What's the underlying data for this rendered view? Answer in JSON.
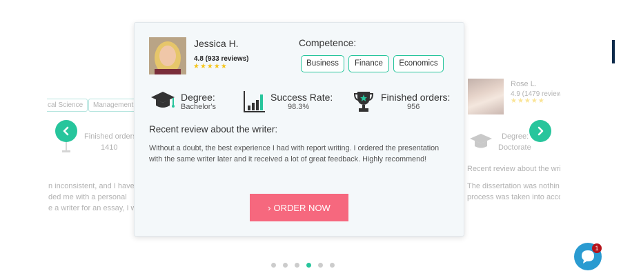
{
  "left_card": {
    "tags": [
      "cal Science",
      "Management"
    ],
    "finished_label": "Finished orders",
    "finished_value": "1410",
    "review_lines": [
      "n inconsistent, and I haven",
      "ded me with a personal",
      "e a writer for an essay, I wi"
    ]
  },
  "right_card": {
    "name": "Rose L.",
    "rating": "4.9 (1479 review",
    "stars": "★★★★★",
    "degree_label": "Degree:",
    "degree_value": "Doctorate",
    "review_title": "Recent review about the wri",
    "review_lines": [
      "The dissertation was nothin",
      "process was taken into acco"
    ]
  },
  "main_card": {
    "writer_name": "Jessica H.",
    "rating": "4.8 (933 reviews)",
    "stars": "★★★★★",
    "competence_title": "Competence:",
    "competence": [
      "Business",
      "Finance",
      "Economics"
    ],
    "degree_label": "Degree:",
    "degree_value": "Bachelor's",
    "success_label": "Success Rate:",
    "success_value": "98.3%",
    "finished_label": "Finished orders:",
    "finished_value": "956",
    "review_title": "Recent review about the writer:",
    "review_text": "Without a doubt, the best experience I had with report writing. I ordered the presentation with the same writer later and it received a lot of great feedback. Highly recommend!",
    "order_label": "ORDER NOW",
    "order_icon": "chevron-right-icon"
  },
  "pagination": {
    "count": 6,
    "active_index": 3
  },
  "chat": {
    "badge": "1"
  },
  "colors": {
    "accent": "#27c59c",
    "order_button": "#f6687e",
    "chat": "#2a9bd1",
    "stars": "#f5c518"
  }
}
